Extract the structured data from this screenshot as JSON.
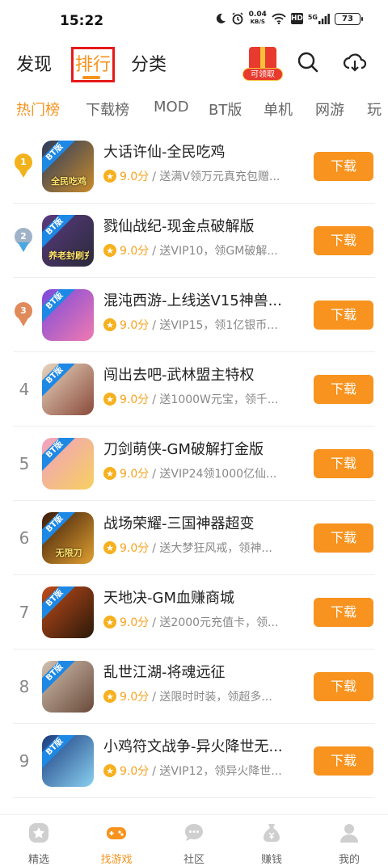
{
  "status_bar": {
    "time": "15:22",
    "net_speed_value": "0.04",
    "net_speed_unit": "KB/S",
    "hd": "HD",
    "signal": "5G",
    "battery": "73"
  },
  "header": {
    "tabs": [
      "发现",
      "排行",
      "分类"
    ],
    "active_tab": "排行",
    "gift_label": "可领取",
    "icons": [
      "gift-icon",
      "search-icon",
      "download-cloud-icon"
    ]
  },
  "categories": [
    "热门榜",
    "下载榜",
    "MOD",
    "BT版",
    "单机",
    "网游",
    "玩"
  ],
  "active_category": "热门榜",
  "colors": {
    "accent": "#f7931e",
    "highlight_box": "#e61a1a",
    "gold": "#f2b21b",
    "silver": "#9fb3c8",
    "bronze": "#e08a5a"
  },
  "list": [
    {
      "rank": "1",
      "title": "大话许仙-全民吃鸡",
      "score": "9.0分",
      "desc": "/ 送满V领万元真充包赠...",
      "button": "下载",
      "icon_badge": "BT版",
      "icon_text": "全民吃鸡"
    },
    {
      "rank": "2",
      "title": "戮仙战纪-现金点破解版",
      "score": "9.0分",
      "desc": "/ 送VIP10，领GM破解...",
      "button": "下载",
      "icon_badge": "BT版",
      "icon_text": "养老封刷充"
    },
    {
      "rank": "3",
      "title": "混沌西游-上线送V15神兽...",
      "score": "9.0分",
      "desc": "/ 送VIP15，领1亿银币...",
      "button": "下载",
      "icon_badge": "BT版",
      "icon_text": ""
    },
    {
      "rank": "4",
      "title": "闯出去吧-武林盟主特权",
      "score": "9.0分",
      "desc": "/ 送1000W元宝，领千...",
      "button": "下载",
      "icon_badge": "BT版",
      "icon_text": ""
    },
    {
      "rank": "5",
      "title": "刀剑萌侠-GM破解打金版",
      "score": "9.0分",
      "desc": "/ 送VIP24领1000亿仙...",
      "button": "下载",
      "icon_badge": "BT版",
      "icon_text": ""
    },
    {
      "rank": "6",
      "title": "战场荣耀-三国神器超变",
      "score": "9.0分",
      "desc": "/ 送大梦狂风戒，领神...",
      "button": "下载",
      "icon_badge": "BT版",
      "icon_text": "无限刀"
    },
    {
      "rank": "7",
      "title": "天地决-GM血赚商城",
      "score": "9.0分",
      "desc": "/ 送2000元充值卡，领...",
      "button": "下载",
      "icon_badge": "BT版",
      "icon_text": ""
    },
    {
      "rank": "8",
      "title": "乱世江湖-将魂远征",
      "score": "9.0分",
      "desc": "/ 送限时时装，领超多...",
      "button": "下载",
      "icon_badge": "BT版",
      "icon_text": ""
    },
    {
      "rank": "9",
      "title": "小鸡符文战争-异火降世无...",
      "score": "9.0分",
      "desc": "/ 送VIP12，领异火降世...",
      "button": "下载",
      "icon_badge": "BT版",
      "icon_text": ""
    }
  ],
  "bottom_nav": [
    {
      "label": "精选",
      "icon": "star-icon",
      "active": false
    },
    {
      "label": "找游戏",
      "icon": "gamepad-icon",
      "active": true
    },
    {
      "label": "社区",
      "icon": "chat-bubble-icon",
      "active": false
    },
    {
      "label": "赚钱",
      "icon": "money-bag-icon",
      "active": false
    },
    {
      "label": "我的",
      "icon": "user-icon",
      "active": false
    }
  ]
}
